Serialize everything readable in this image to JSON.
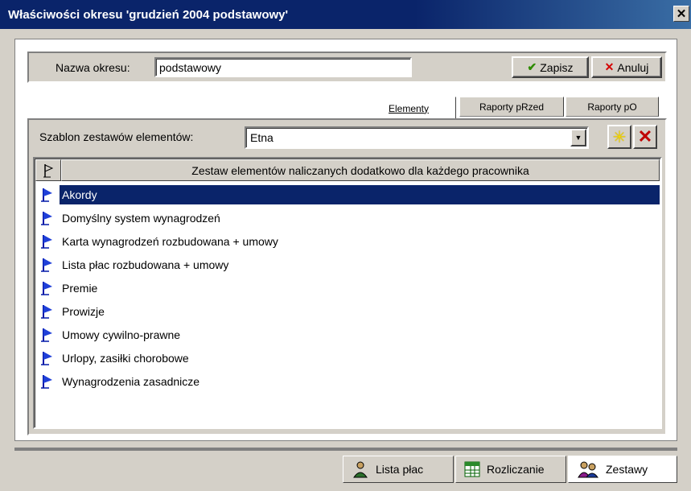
{
  "window": {
    "title": "Właściwości okresu 'grudzień 2004 podstawowy'",
    "close_label": "✕"
  },
  "period": {
    "name_label": "Nazwa okresu:",
    "name_value": "podstawowy",
    "save_label": "Zapisz",
    "cancel_label": "Anuluj"
  },
  "tabs": [
    {
      "label": "Elementy",
      "active": true
    },
    {
      "label": "Raporty pRzed",
      "active": false
    },
    {
      "label": "Raporty pO",
      "active": false
    }
  ],
  "template": {
    "label": "Szablon zestawów elementów:",
    "value": "Etna"
  },
  "grid": {
    "header": "Zestaw elementów naliczanych dodatkowo dla każdego pracownika",
    "rows": [
      {
        "label": "Akordy",
        "selected": true
      },
      {
        "label": "Domyślny system wynagrodzeń"
      },
      {
        "label": "Karta wynagrodzeń rozbudowana + umowy"
      },
      {
        "label": "Lista płac rozbudowana + umowy"
      },
      {
        "label": "Premie"
      },
      {
        "label": "Prowizje"
      },
      {
        "label": "Umowy cywilno-prawne"
      },
      {
        "label": "Urlopy, zasiłki chorobowe"
      },
      {
        "label": "Wynagrodzenia zasadnicze"
      }
    ]
  },
  "bottom_tabs": [
    {
      "label": "Lista płac",
      "icon": "person-icon"
    },
    {
      "label": "Rozliczanie",
      "icon": "spreadsheet-icon"
    },
    {
      "label": "Zestawy",
      "icon": "people-icon",
      "active": true
    }
  ],
  "colors": {
    "titlebar": "#0a246a",
    "selection": "#0a246a",
    "face": "#d4d0c8"
  }
}
